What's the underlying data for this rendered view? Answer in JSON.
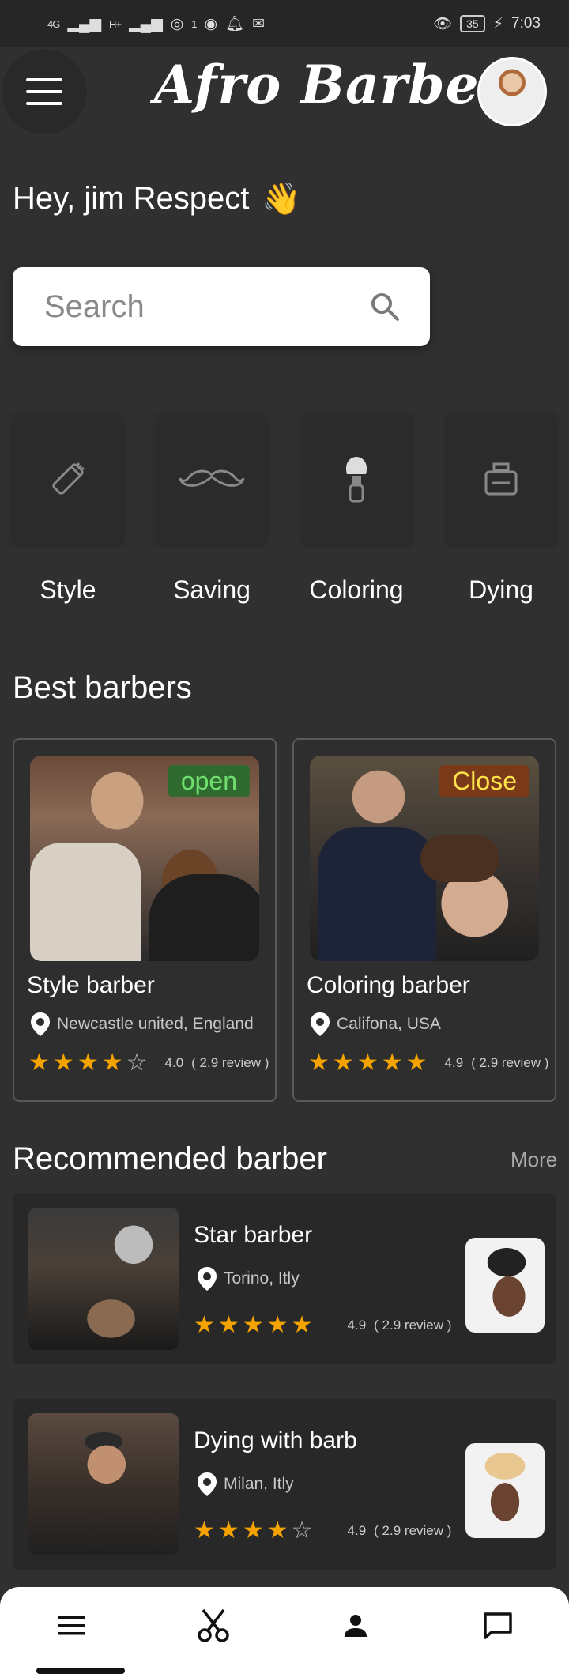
{
  "status_bar": {
    "network_1": "4G",
    "network_2": "H+",
    "notification_count": "1",
    "battery": "35",
    "time": "7:03"
  },
  "header": {
    "app_title": "Afro Barber"
  },
  "greeting": {
    "text": "Hey,  jim Respect",
    "emoji": "👋"
  },
  "search": {
    "placeholder": "Search"
  },
  "categories": [
    {
      "label": "Style",
      "icon": "clipper-icon"
    },
    {
      "label": "Saving",
      "icon": "mustache-icon"
    },
    {
      "label": "Coloring",
      "icon": "shaving-brush-icon"
    },
    {
      "label": "Dying",
      "icon": "dye-bottle-icon"
    }
  ],
  "best_barbers": {
    "title": "Best barbers",
    "items": [
      {
        "name": "Style barber",
        "location": "Newcastle united, England",
        "status": "open",
        "rating": "4.0",
        "reviews": "( 2.9 review )",
        "stars": 4
      },
      {
        "name": "Coloring barber",
        "location": "Califona, USA",
        "status": "Close",
        "rating": "4.9",
        "reviews": "( 2.9 review )",
        "stars": 5
      }
    ]
  },
  "recommended": {
    "title": "Recommended barber",
    "more_label": "More",
    "items": [
      {
        "name": "Star barber",
        "location": "Torino, Itly",
        "rating": "4.9",
        "reviews": "( 2.9 review )",
        "stars": 5
      },
      {
        "name": "Dying with barb",
        "location": "Milan, Itly",
        "rating": "4.9",
        "reviews": "( 2.9 review )",
        "stars": 4
      }
    ]
  },
  "bottom_nav": [
    "menu-icon",
    "scissors-icon",
    "person-icon",
    "chat-icon"
  ],
  "colors": {
    "background": "#303030",
    "star": "#f5a300",
    "open_badge_text": "#6fe06f",
    "close_badge_text": "#ffe24a"
  }
}
